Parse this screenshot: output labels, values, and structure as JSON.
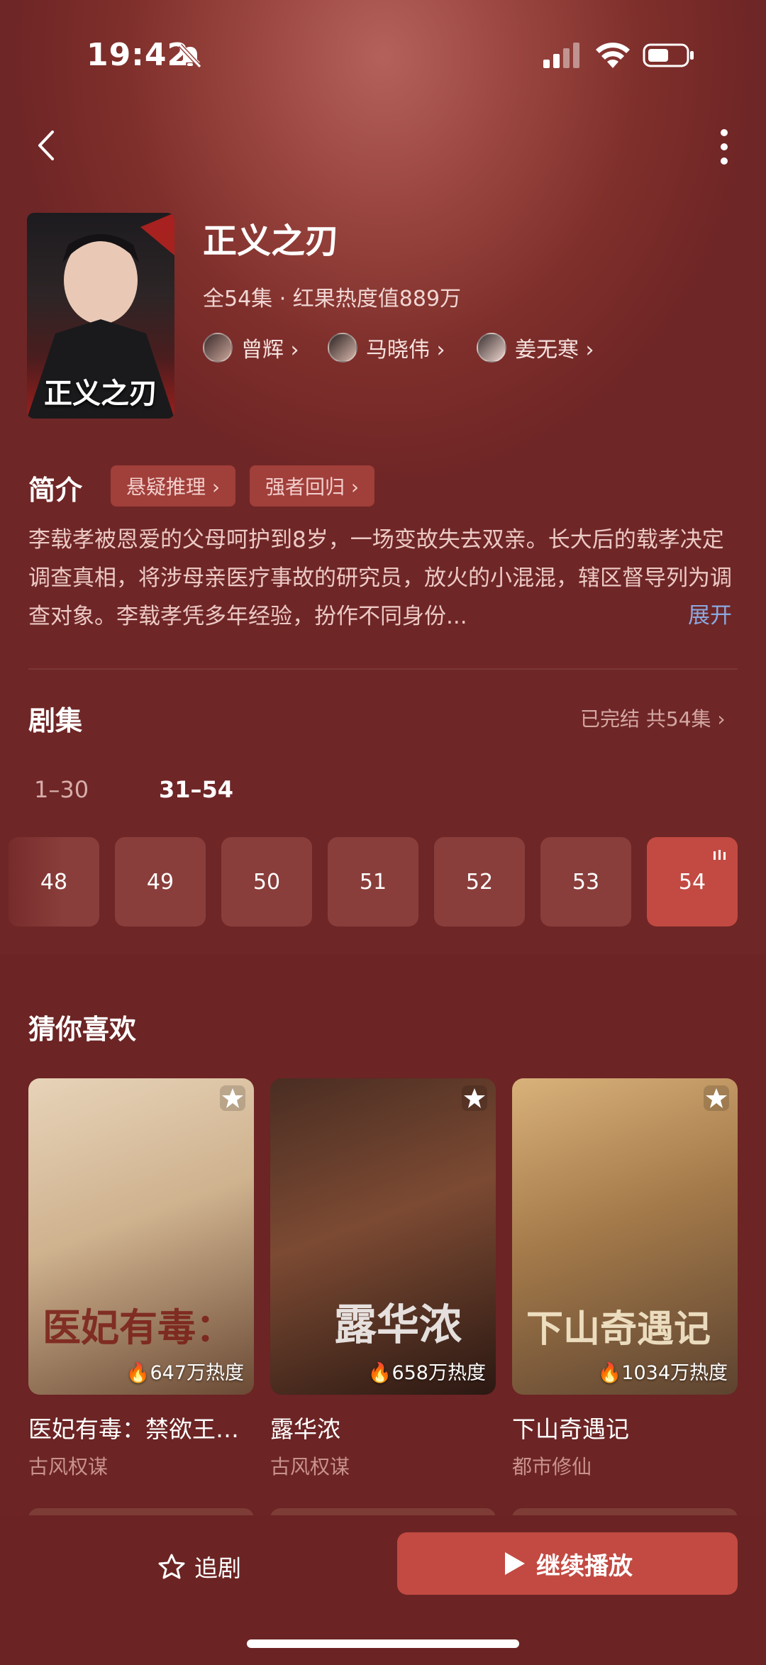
{
  "status_bar": {
    "time": "19:42"
  },
  "drama": {
    "title": "正义之刃",
    "meta": "全54集 · 红果热度值889万",
    "poster_text": "正义之刃",
    "actors": [
      {
        "name": "曾辉 ›"
      },
      {
        "name": "马晓伟 ›"
      },
      {
        "name": "姜无寒 ›"
      }
    ]
  },
  "intro": {
    "heading": "简介",
    "tags": [
      "悬疑推理 ›",
      "强者回归 ›"
    ],
    "text": "李载孝被恩爱的父母呵护到8岁，一场变故失去双亲。长大后的载孝决定调查真相，将涉母亲医疗事故的研究员，放火的小混混，辖区督导列为调查对象。李载孝凭多年经验，扮作不同身份...",
    "expand_label": "展开"
  },
  "episodes": {
    "heading": "剧集",
    "status": "已完结 共54集 ›",
    "ranges": [
      "1–30",
      "31–54"
    ],
    "items": [
      "48",
      "49",
      "50",
      "51",
      "52",
      "53",
      "54"
    ],
    "current": "54"
  },
  "recommend": {
    "heading": "猜你喜欢",
    "items": [
      {
        "title": "医妃有毒：禁欲王…",
        "category": "古风权谋",
        "heat": "647万热度",
        "art": "医妃有毒："
      },
      {
        "title": "露华浓",
        "category": "古风权谋",
        "heat": "658万热度",
        "art": "露华浓"
      },
      {
        "title": "下山奇遇记",
        "category": "都市修仙",
        "heat": "1034万热度",
        "art": "下山奇遇记"
      }
    ]
  },
  "bottom_bar": {
    "follow_label": "追剧",
    "play_label": "继续播放"
  },
  "colors": {
    "accent": "#c24a42",
    "background": "#6f2626",
    "link": "#8aa9e0"
  }
}
